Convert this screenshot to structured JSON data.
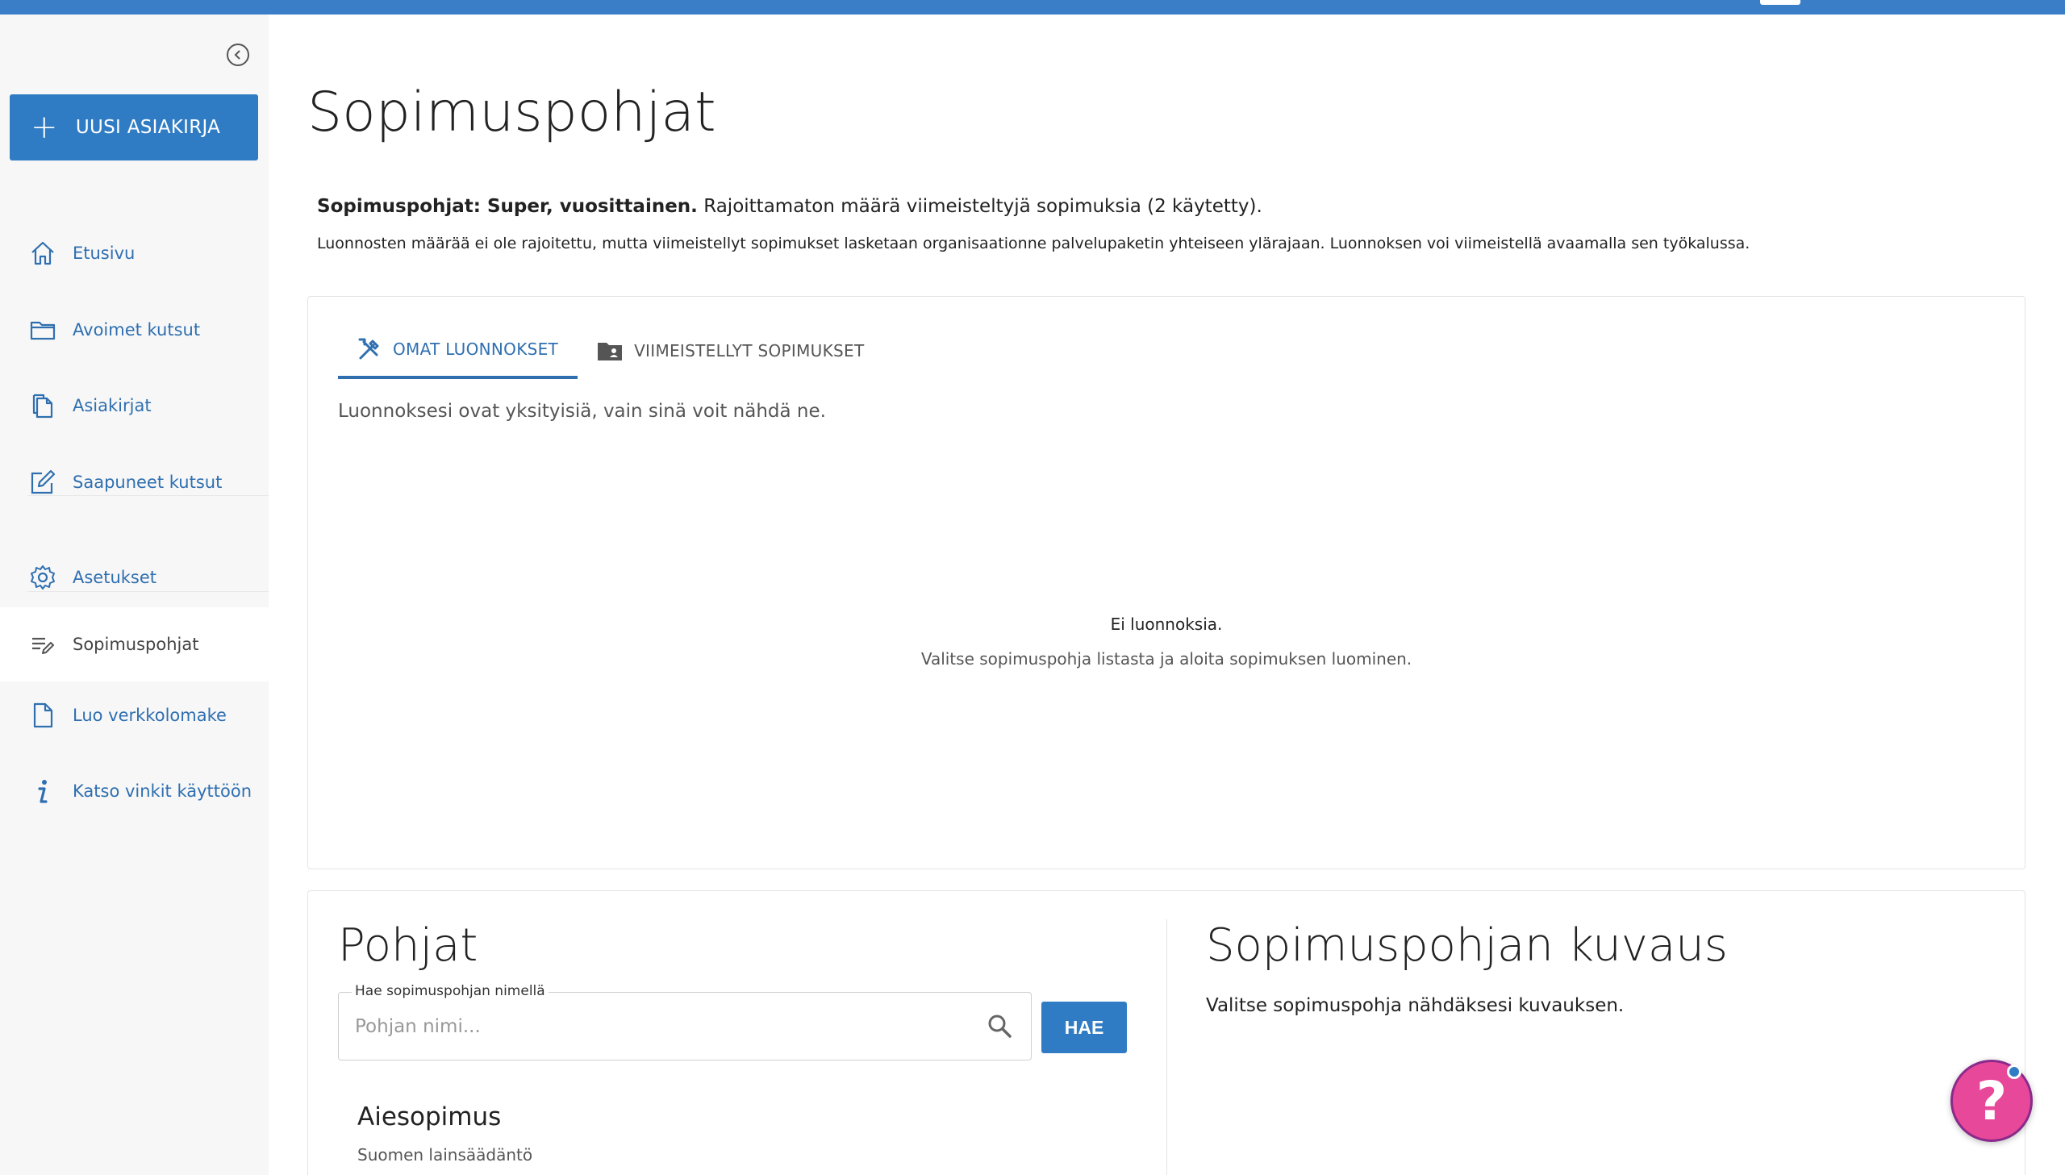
{
  "sidebar": {
    "new_document_label": "UUSI ASIAKIRJA",
    "items": [
      {
        "label": "Etusivu",
        "icon": "home-icon"
      },
      {
        "label": "Avoimet kutsut",
        "icon": "folder-icon"
      },
      {
        "label": "Asiakirjat",
        "icon": "documents-icon"
      },
      {
        "label": "Saapuneet kutsut",
        "icon": "edit-icon"
      },
      {
        "label": "Asetukset",
        "icon": "gear-icon"
      },
      {
        "label": "Sopimuspohjat",
        "icon": "template-list-icon"
      },
      {
        "label": "Luo verkkolomake",
        "icon": "file-icon"
      },
      {
        "label": "Katso vinkit käyttöön",
        "icon": "info-icon"
      }
    ]
  },
  "main": {
    "title": "Sopimuspohjat",
    "plan_bold": "Sopimuspohjat: Super, vuosittainen.",
    "plan_text": " Rajoittamaton määrä viimeisteltyjä sopimuksia (2 käytetty).",
    "plan_sub": "Luonnosten määrää ei ole rajoitettu, mutta viimeistellyt sopimukset lasketaan organisaationne palvelupaketin yhteiseen ylärajaan. Luonnoksen voi viimeistellä avaamalla sen työkalussa.",
    "tabs": [
      {
        "label": "OMAT LUONNOKSET",
        "icon": "tools-icon",
        "active": true
      },
      {
        "label": "VIIMEISTELLYT SOPIMUKSET",
        "icon": "shared-folder-icon",
        "active": false
      }
    ],
    "privacy_note": "Luonnoksesi ovat yksityisiä, vain sinä voit nähdä ne.",
    "empty_title": "Ei luonnoksia.",
    "empty_sub": "Valitse sopimuspohja listasta ja aloita sopimuksen luominen."
  },
  "templates": {
    "heading": "Pohjat",
    "search_label": "Hae sopimuspohjan nimellä",
    "search_placeholder": "Pohjan nimi...",
    "search_button": "HAE",
    "items": [
      {
        "title": "Aiesopimus",
        "subtitle": "Suomen lainsäädäntö"
      }
    ]
  },
  "description": {
    "heading": "Sopimuspohjan kuvaus",
    "text": "Valitse sopimuspohja nähdäksesi kuvauksen."
  },
  "help": {
    "label": "?"
  },
  "colors": {
    "accent": "#2f7cc4",
    "topbar": "#3a7ec8",
    "help": "#e8489a"
  }
}
